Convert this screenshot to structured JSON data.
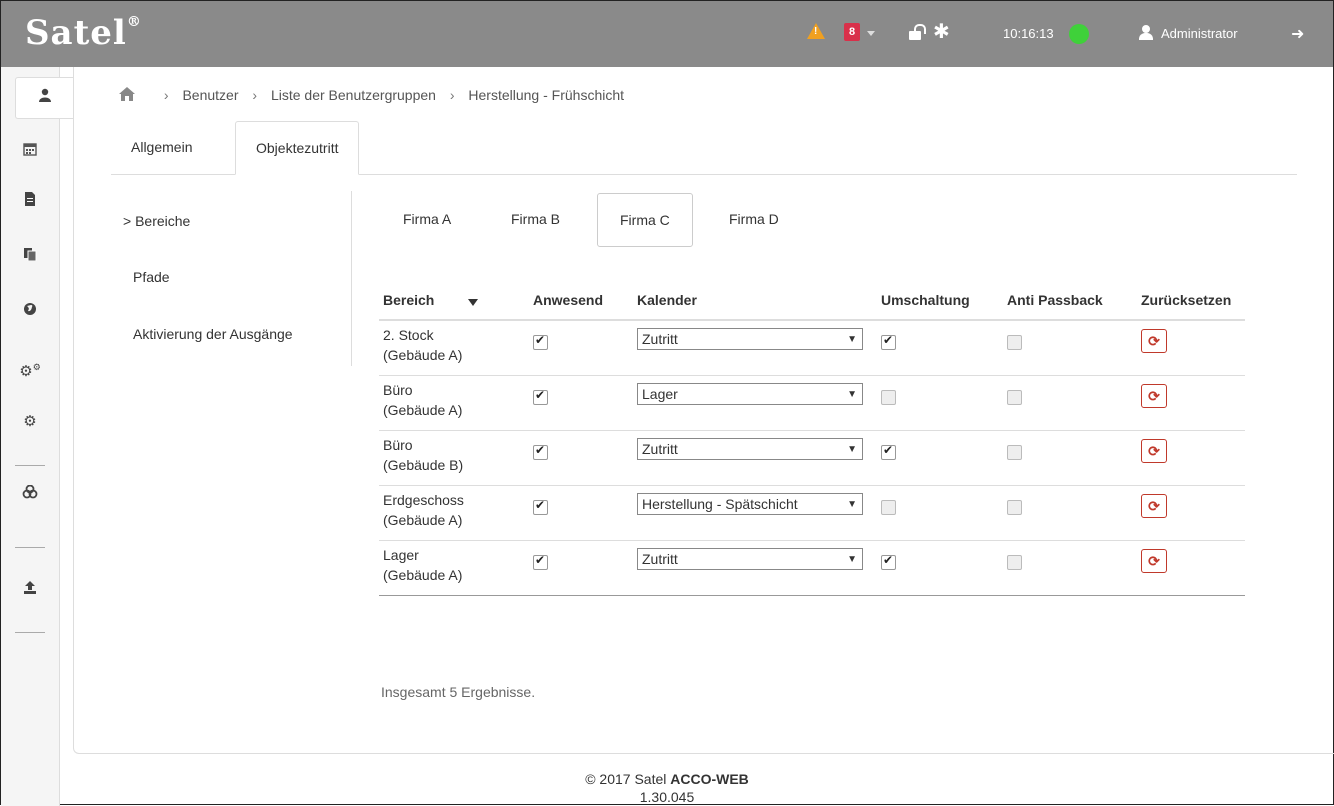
{
  "header": {
    "logo": "Satel",
    "logo_mark": "®",
    "alert_icon": "warning-triangle",
    "notification_count": "8",
    "clock": "10:16:13",
    "status_color": "#3fd13a",
    "user": "Administrator"
  },
  "sidebar": {
    "items": [
      {
        "icon": "user-icon"
      },
      {
        "icon": "calendar-icon"
      },
      {
        "icon": "document-icon"
      },
      {
        "icon": "copy-icon"
      },
      {
        "icon": "globe-icon"
      },
      {
        "icon": "gears-icon"
      },
      {
        "icon": "gear-icon"
      },
      {
        "icon": "link-icon"
      },
      {
        "icon": "upload-icon"
      }
    ]
  },
  "breadcrumb": {
    "items": [
      "Benutzer",
      "Liste der Benutzergruppen",
      "Herstellung - Frühschicht"
    ],
    "separator": "›"
  },
  "tabs": {
    "general": "Allgemein",
    "access": "Objektezutritt"
  },
  "subnav": {
    "areas": "Bereiche",
    "areas_prefix": ">",
    "paths": "Pfade",
    "outputs": "Aktivierung der Ausgänge"
  },
  "companies": [
    "Firma A",
    "Firma B",
    "Firma C",
    "Firma D"
  ],
  "table": {
    "headers": {
      "area": "Bereich",
      "present": "Anwesend",
      "calendar": "Kalender",
      "switching": "Umschaltung",
      "antipassback": "Anti Passback",
      "reset": "Zurücksetzen"
    },
    "rows": [
      {
        "area": "2. Stock",
        "building": "(Gebäude A)",
        "present": true,
        "calendar": "Zutritt",
        "switching": true,
        "antipassback": false
      },
      {
        "area": "Büro",
        "building": "(Gebäude A)",
        "present": true,
        "calendar": "Lager",
        "switching": false,
        "antipassback": false
      },
      {
        "area": "Büro",
        "building": "(Gebäude B)",
        "present": true,
        "calendar": "Zutritt",
        "switching": true,
        "antipassback": false
      },
      {
        "area": "Erdgeschoss",
        "building": "(Gebäude A)",
        "present": true,
        "calendar": "Herstellung - Spätschicht",
        "switching": false,
        "antipassback": false
      },
      {
        "area": "Lager",
        "building": "(Gebäude A)",
        "present": true,
        "calendar": "Zutritt",
        "switching": true,
        "antipassback": false
      }
    ]
  },
  "summary": "Insgesamt 5 Ergebnisse.",
  "footer": {
    "copyright": "© 2017 Satel",
    "product": "ACCO-WEB",
    "version": "1.30.045"
  },
  "colors": {
    "topbar": "#8a8a8a",
    "alert": "#f0a020",
    "badge": "#d9304a",
    "reset": "#c0392b"
  }
}
